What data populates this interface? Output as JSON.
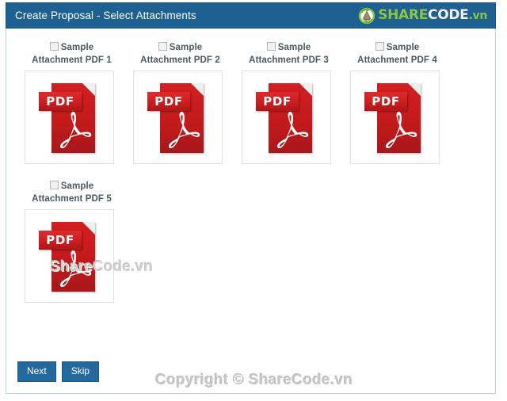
{
  "header": {
    "title": "Create Proposal - Select Attachments",
    "logo": {
      "mark": "recycle-leaf-icon",
      "part1": "SHARE",
      "part2": "CODE",
      "part3": ".vn"
    },
    "colors": {
      "header_bg": "#1d6091",
      "logo_green": "#8cc63f",
      "logo_cream": "#f3efe2"
    }
  },
  "attachments": [
    {
      "label_line1": "Sample",
      "label_line2": "Attachment PDF 1",
      "checked": false,
      "icon": "pdf-file-icon",
      "icon_text": "PDF"
    },
    {
      "label_line1": "Sample",
      "label_line2": "Attachment PDF 2",
      "checked": false,
      "icon": "pdf-file-icon",
      "icon_text": "PDF"
    },
    {
      "label_line1": "Sample",
      "label_line2": "Attachment PDF 3",
      "checked": false,
      "icon": "pdf-file-icon",
      "icon_text": "PDF"
    },
    {
      "label_line1": "Sample",
      "label_line2": "Attachment PDF 4",
      "checked": false,
      "icon": "pdf-file-icon",
      "icon_text": "PDF"
    },
    {
      "label_line1": "Sample",
      "label_line2": "Attachment PDF 5",
      "checked": false,
      "icon": "pdf-file-icon",
      "icon_text": "PDF"
    }
  ],
  "buttons": {
    "next": "Next",
    "skip": "Skip"
  },
  "watermarks": {
    "middle": "ShareCode.vn",
    "bottom": "Copyright © ShareCode.vn"
  }
}
